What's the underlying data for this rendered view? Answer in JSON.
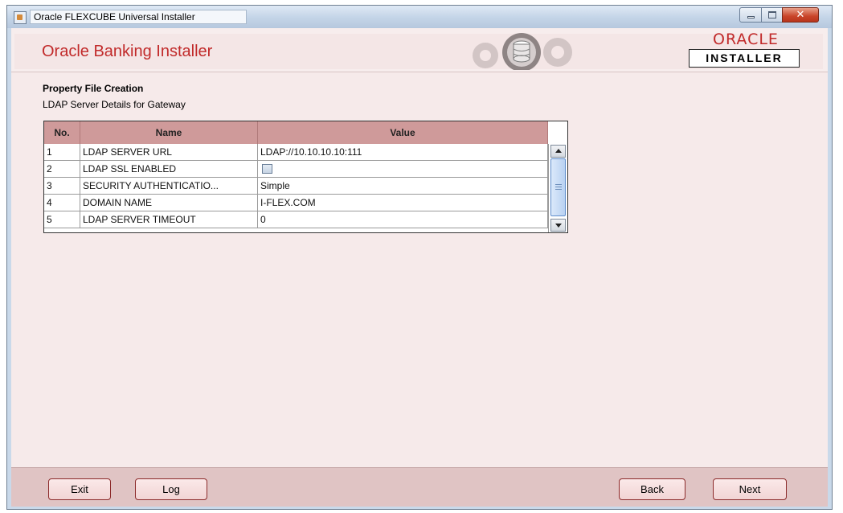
{
  "window": {
    "title": "Oracle FLEXCUBE Universal Installer",
    "close_glyph": "✕"
  },
  "header": {
    "app_title": "Oracle Banking Installer",
    "oracle_logo": "ORACLE",
    "installer_label": "INSTALLER"
  },
  "section": {
    "title": "Property File Creation",
    "subtitle": "LDAP Server Details for Gateway"
  },
  "table": {
    "columns": [
      "No.",
      "Name",
      "Value"
    ],
    "rows": [
      {
        "no": "1",
        "name": "LDAP SERVER URL",
        "value": "LDAP://10.10.10.10:111"
      },
      {
        "no": "2",
        "name": "LDAP SSL ENABLED",
        "value": "",
        "checkbox": false
      },
      {
        "no": "3",
        "name": "SECURITY AUTHENTICATIO...",
        "value": "Simple"
      },
      {
        "no": "4",
        "name": "DOMAIN NAME",
        "value": "I-FLEX.COM"
      },
      {
        "no": "5",
        "name": "LDAP SERVER TIMEOUT",
        "value": "0"
      }
    ]
  },
  "footer": {
    "exit_label": "Exit",
    "log_label": "Log",
    "back_label": "Back",
    "next_label": "Next"
  },
  "colors": {
    "accent_red": "#c12a2a",
    "header_cell": "#cf9a9a",
    "panel_bg": "#f6eaea",
    "footer_bg": "#e0c4c4"
  }
}
